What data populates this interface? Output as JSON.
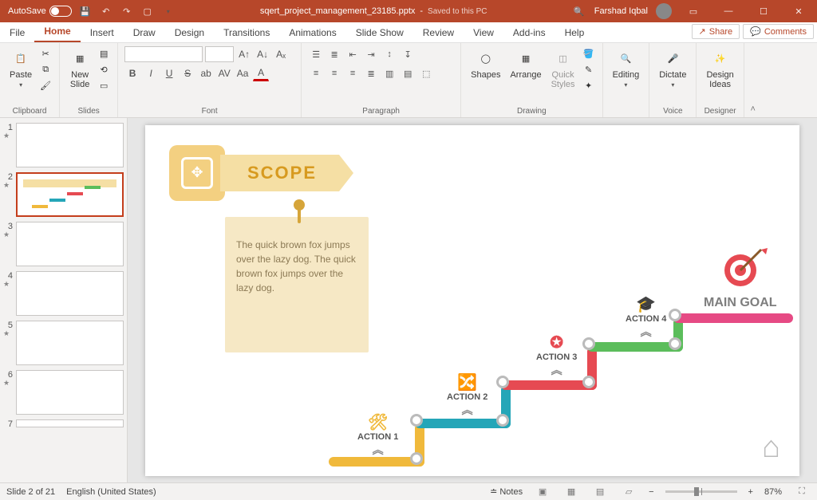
{
  "title_bar": {
    "autosave_label": "AutoSave",
    "autosave_state": "Off",
    "file_name": "sqert_project_management_23185.pptx",
    "saved_state": "Saved to this PC",
    "user_name": "Farshad Iqbal"
  },
  "tabs": {
    "items": [
      "File",
      "Home",
      "Insert",
      "Draw",
      "Design",
      "Transitions",
      "Animations",
      "Slide Show",
      "Review",
      "View",
      "Add-ins",
      "Help"
    ],
    "active_index": 1,
    "share": "Share",
    "comments": "Comments"
  },
  "ribbon": {
    "clipboard": {
      "paste": "Paste",
      "label": "Clipboard"
    },
    "slides": {
      "new_slide": "New\nSlide",
      "label": "Slides"
    },
    "font": {
      "label": "Font"
    },
    "paragraph": {
      "label": "Paragraph"
    },
    "drawing": {
      "shapes": "Shapes",
      "arrange": "Arrange",
      "quick": "Quick\nStyles",
      "label": "Drawing"
    },
    "editing": {
      "label": "Editing",
      "btn": "Editing"
    },
    "voice": {
      "dictate": "Dictate",
      "label": "Voice"
    },
    "designer": {
      "ideas": "Design\nIdeas",
      "label": "Designer"
    }
  },
  "thumbs": {
    "visible": [
      "1",
      "2",
      "3",
      "4",
      "5",
      "6",
      "7"
    ],
    "active_index": 1
  },
  "slide": {
    "scope_title": "SCOPE",
    "sticky_text": "The quick brown fox jumps over the lazy dog. The quick brown fox jumps over the lazy dog.",
    "actions": [
      "ACTION 1",
      "ACTION 2",
      "ACTION 3",
      "ACTION 4"
    ],
    "main_goal": "MAIN GOAL",
    "step_colors": [
      "#f0b93b",
      "#25a6b8",
      "#e64a52",
      "#5bbd5b",
      "#e64a84"
    ]
  },
  "status": {
    "slide_info": "Slide 2 of 21",
    "language": "English (United States)",
    "notes": "Notes",
    "zoom": "87%"
  }
}
